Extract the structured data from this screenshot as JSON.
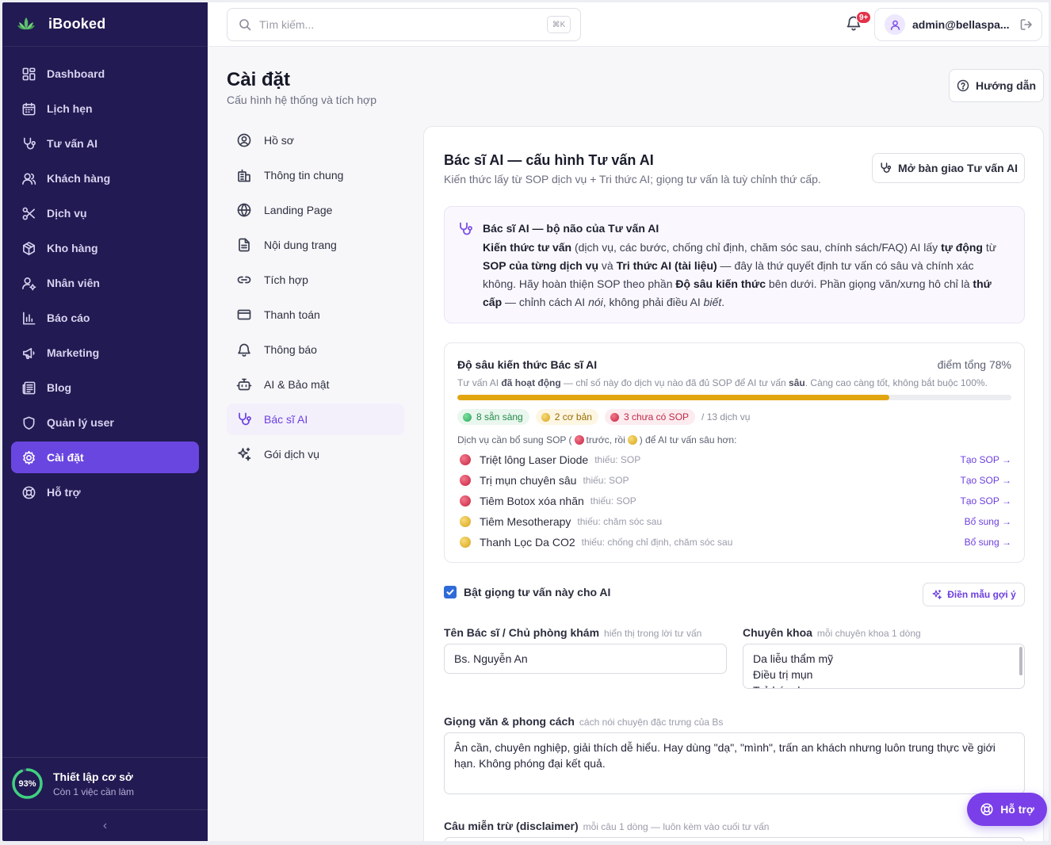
{
  "app": {
    "name": "iBooked"
  },
  "sidebar": {
    "items": [
      {
        "label": "Dashboard",
        "icon": "grid-icon"
      },
      {
        "label": "Lịch hẹn",
        "icon": "calendar-icon"
      },
      {
        "label": "Tư vấn AI",
        "icon": "stethoscope-icon"
      },
      {
        "label": "Khách hàng",
        "icon": "users-icon"
      },
      {
        "label": "Dịch vụ",
        "icon": "scissors-icon"
      },
      {
        "label": "Kho hàng",
        "icon": "package-icon"
      },
      {
        "label": "Nhân viên",
        "icon": "user-cog-icon"
      },
      {
        "label": "Báo cáo",
        "icon": "bar-chart-icon"
      },
      {
        "label": "Marketing",
        "icon": "megaphone-icon"
      },
      {
        "label": "Blog",
        "icon": "newspaper-icon"
      },
      {
        "label": "Quản lý user",
        "icon": "shield-icon"
      },
      {
        "label": "Cài đặt",
        "icon": "gear-icon",
        "active": true
      },
      {
        "label": "Hỗ trợ",
        "icon": "lifebuoy-icon"
      }
    ],
    "setup": {
      "percent_label": "93%",
      "progress": 0.93,
      "title": "Thiết lập cơ sở",
      "subtitle": "Còn 1 việc cần làm"
    },
    "collapse_label": "‹"
  },
  "topbar": {
    "search_placeholder": "Tìm kiếm...",
    "search_shortcut": "⌘K",
    "notification_count": "9+",
    "user_email": "admin@bellaspa..."
  },
  "page": {
    "title": "Cài đặt",
    "subtitle": "Cấu hình hệ thống và tích hợp",
    "guide_label": "Hướng dẫn"
  },
  "settings_menu": [
    {
      "label": "Hồ sơ",
      "icon": "user-circle-icon"
    },
    {
      "label": "Thông tin chung",
      "icon": "building-icon"
    },
    {
      "label": "Landing Page",
      "icon": "globe-icon"
    },
    {
      "label": "Nội dung trang",
      "icon": "file-text-icon"
    },
    {
      "label": "Tích hợp",
      "icon": "link-icon"
    },
    {
      "label": "Thanh toán",
      "icon": "credit-card-icon"
    },
    {
      "label": "Thông báo",
      "icon": "bell-icon"
    },
    {
      "label": "AI & Bảo mật",
      "icon": "bot-icon"
    },
    {
      "label": "Bác sĩ AI",
      "icon": "stethoscope-icon",
      "active": true
    },
    {
      "label": "Gói dịch vụ",
      "icon": "sparkles-icon"
    }
  ],
  "card": {
    "title": "Bác sĩ AI — cấu hình Tư vấn AI",
    "subtitle": "Kiến thức lấy từ SOP dịch vụ + Tri thức AI; giọng tư vấn là tuỳ chỉnh thứ cấp.",
    "handoff_label": "Mở bàn giao Tư vấn AI",
    "info": {
      "title": "Bác sĩ AI — bộ não của Tư vấn AI",
      "p1": "Kiến thức tư vấn",
      "p2": " (dịch vụ, các bước, chống chỉ định, chăm sóc sau, chính sách/FAQ) AI lấy ",
      "p3": "tự động",
      "p4": " từ ",
      "p5": "SOP của từng dịch vụ",
      "p6": " và ",
      "p7": "Tri thức AI (tài liệu)",
      "p8": " — đây là thứ quyết định tư vấn có sâu và chính xác không. Hãy hoàn thiện SOP theo phần ",
      "p9": "Độ sâu kiến thức",
      "p10": " bên dưới. Phần giọng văn/xưng hô chỉ là ",
      "p11": "thứ cấp",
      "p12": " — chỉnh cách AI ",
      "p13": "nói",
      "p14": ", không phải điều AI ",
      "p15": "biết",
      "p16": "."
    },
    "depth": {
      "title": "Độ sâu kiến thức Bác sĩ AI",
      "score_label": "điểm tổng 78%",
      "score": 0.78,
      "sub_a": "Tư vấn AI ",
      "sub_b": "đã hoạt động",
      "sub_c": " — chỉ số này đo dịch vụ nào đã đủ SOP để AI tư vấn ",
      "sub_d": "sâu",
      "sub_e": ". Càng cao càng tốt, không bắt buộc 100%.",
      "chip_ready": "8 sẵn sàng",
      "chip_basic": "2 cơ bản",
      "chip_missing": "3 chưa có SOP",
      "total": "/ 13 dịch vụ",
      "need_a": "Dịch vụ cần bổ sung SOP (",
      "need_b": " trước, rồi ",
      "need_c": ") để AI tư vấn sâu hơn:",
      "services": [
        {
          "name": "Triệt lông Laser Diode",
          "missing": "thiếu: SOP",
          "action": "Tạo SOP →",
          "status": "red"
        },
        {
          "name": "Trị mụn chuyên sâu",
          "missing": "thiếu: SOP",
          "action": "Tạo SOP →",
          "status": "red"
        },
        {
          "name": "Tiêm Botox xóa nhăn",
          "missing": "thiếu: SOP",
          "action": "Tạo SOP →",
          "status": "red"
        },
        {
          "name": "Tiêm Mesotherapy",
          "missing": "thiếu: chăm sóc sau",
          "action": "Bổ sung →",
          "status": "yellow"
        },
        {
          "name": "Thanh Lọc Da CO2",
          "missing": "thiếu: chống chỉ định, chăm sóc sau",
          "action": "Bổ sung →",
          "status": "yellow"
        }
      ]
    },
    "enable_label": "Bật giọng tư vấn này cho AI",
    "fill_label": "Điền mẫu gợi ý",
    "doctor_name": {
      "label": "Tên Bác sĩ / Chủ phòng khám",
      "hint": "hiển thị trong lời tư vấn",
      "value": "Bs. Nguyễn An"
    },
    "specialty": {
      "label": "Chuyên khoa",
      "hint": "mỗi chuyên khoa 1 dòng",
      "value": "Da liễu thẩm mỹ\nĐiều trị mụn\nTrẻ hóa da"
    },
    "tone": {
      "label": "Giọng văn & phong cách",
      "hint": "cách nói chuyện đặc trưng của Bs",
      "value": "Ân cần, chuyên nghiệp, giải thích dễ hiểu. Hay dùng \"dạ\", \"mình\", trấn an khách nhưng luôn trung thực về giới hạn. Không phóng đại kết quả."
    },
    "disclaimer": {
      "label": "Câu miễn trừ (disclaimer)",
      "hint": "mỗi câu 1 dòng — luôn kèm vào cuối tư vấn"
    }
  },
  "support_label": "Hỗ trợ",
  "colors": {
    "sidebar": "#221a52",
    "accent": "#6a46e0",
    "progress": "#e2a512"
  }
}
